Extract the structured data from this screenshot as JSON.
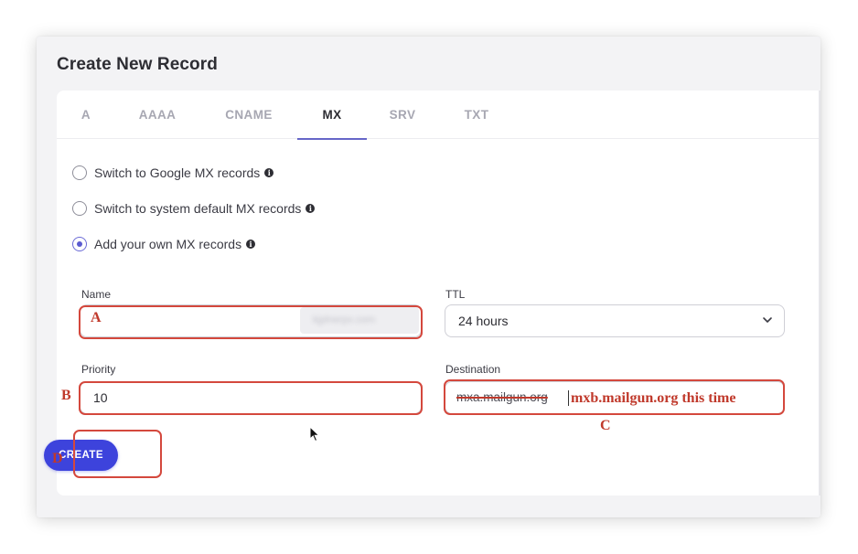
{
  "page": {
    "title": "Create New Record"
  },
  "tabs": [
    {
      "label": "A",
      "active": false
    },
    {
      "label": "AAAA",
      "active": false
    },
    {
      "label": "CNAME",
      "active": false
    },
    {
      "label": "MX",
      "active": true
    },
    {
      "label": "SRV",
      "active": false
    },
    {
      "label": "TXT",
      "active": false
    }
  ],
  "mx_options": [
    {
      "label": "Switch to Google MX records",
      "checked": false,
      "info_icon": "info-icon"
    },
    {
      "label": "Switch to system default MX records",
      "checked": false,
      "info_icon": "info-icon"
    },
    {
      "label": "Add your own MX records",
      "checked": true,
      "info_icon": "info-icon"
    }
  ],
  "form": {
    "name": {
      "label": "Name",
      "value": "",
      "blurred_value": "kjplnerpx.com"
    },
    "ttl": {
      "label": "TTL",
      "value": "24 hours"
    },
    "priority": {
      "label": "Priority",
      "value": "10"
    },
    "destination": {
      "label": "Destination",
      "value": "mxa.mailgun.org",
      "struck_through": true
    },
    "create_label": "CREATE"
  },
  "annotations": {
    "a": "A",
    "b": "B",
    "c": "C",
    "d": "D",
    "destination_note": "mxb.mailgun.org this time",
    "color": "#c0392b"
  },
  "colors": {
    "accent": "#3d43dc",
    "tab_underline": "#6666c8",
    "annotation": "#d4483d"
  }
}
